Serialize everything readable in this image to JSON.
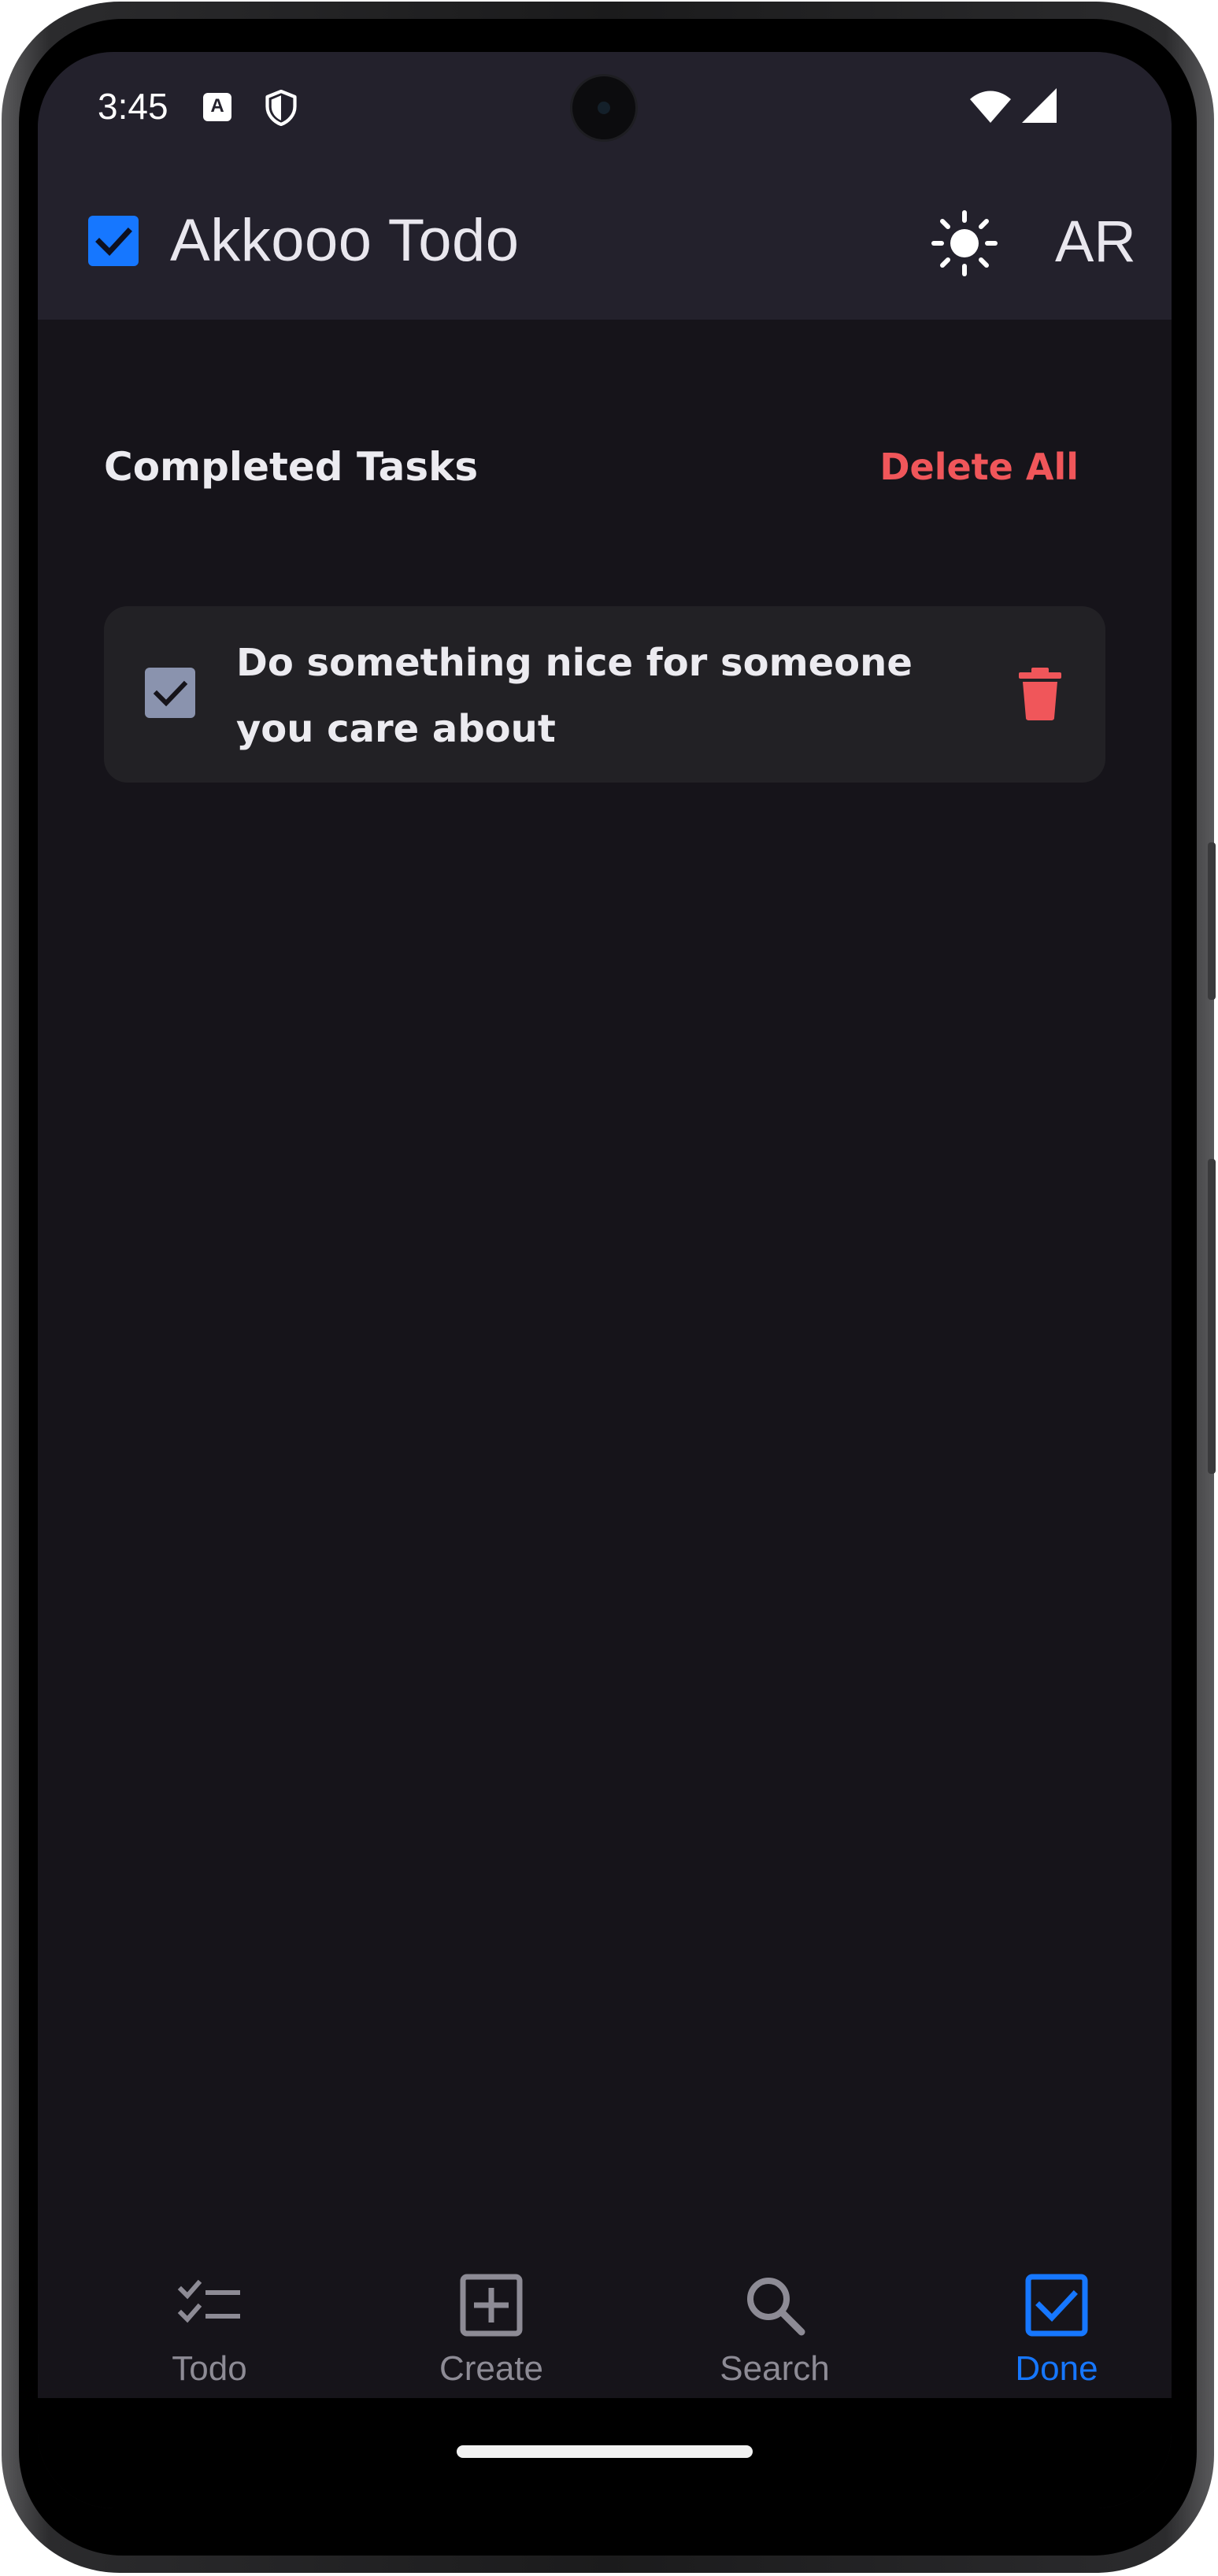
{
  "status_bar": {
    "time": "3:45",
    "icons": [
      "keyboard-a-icon",
      "shield-icon",
      "wifi-icon",
      "signal-icon"
    ]
  },
  "app_bar": {
    "title": "Akkooo Todo",
    "logo_icon": "checkbox-checked-icon",
    "theme_toggle_icon": "sun-icon",
    "language_label": "AR"
  },
  "section": {
    "title": "Completed Tasks",
    "delete_all_label": "Delete All"
  },
  "tasks": [
    {
      "text": "Do something nice for someone you care about",
      "completed": true,
      "delete_icon": "trash-icon"
    }
  ],
  "bottom_nav": {
    "items": [
      {
        "label": "Todo",
        "icon": "checklist-icon",
        "active": false
      },
      {
        "label": "Create",
        "icon": "add-box-icon",
        "active": false
      },
      {
        "label": "Search",
        "icon": "search-icon",
        "active": false
      },
      {
        "label": "Done",
        "icon": "checkbox-checked-icon",
        "active": true
      }
    ]
  },
  "colors": {
    "accent": "#1677ff",
    "danger": "#f0565a",
    "background": "#16141a",
    "app_bar": "#23212c",
    "card": "#222125",
    "inactive": "#8d8b95"
  }
}
